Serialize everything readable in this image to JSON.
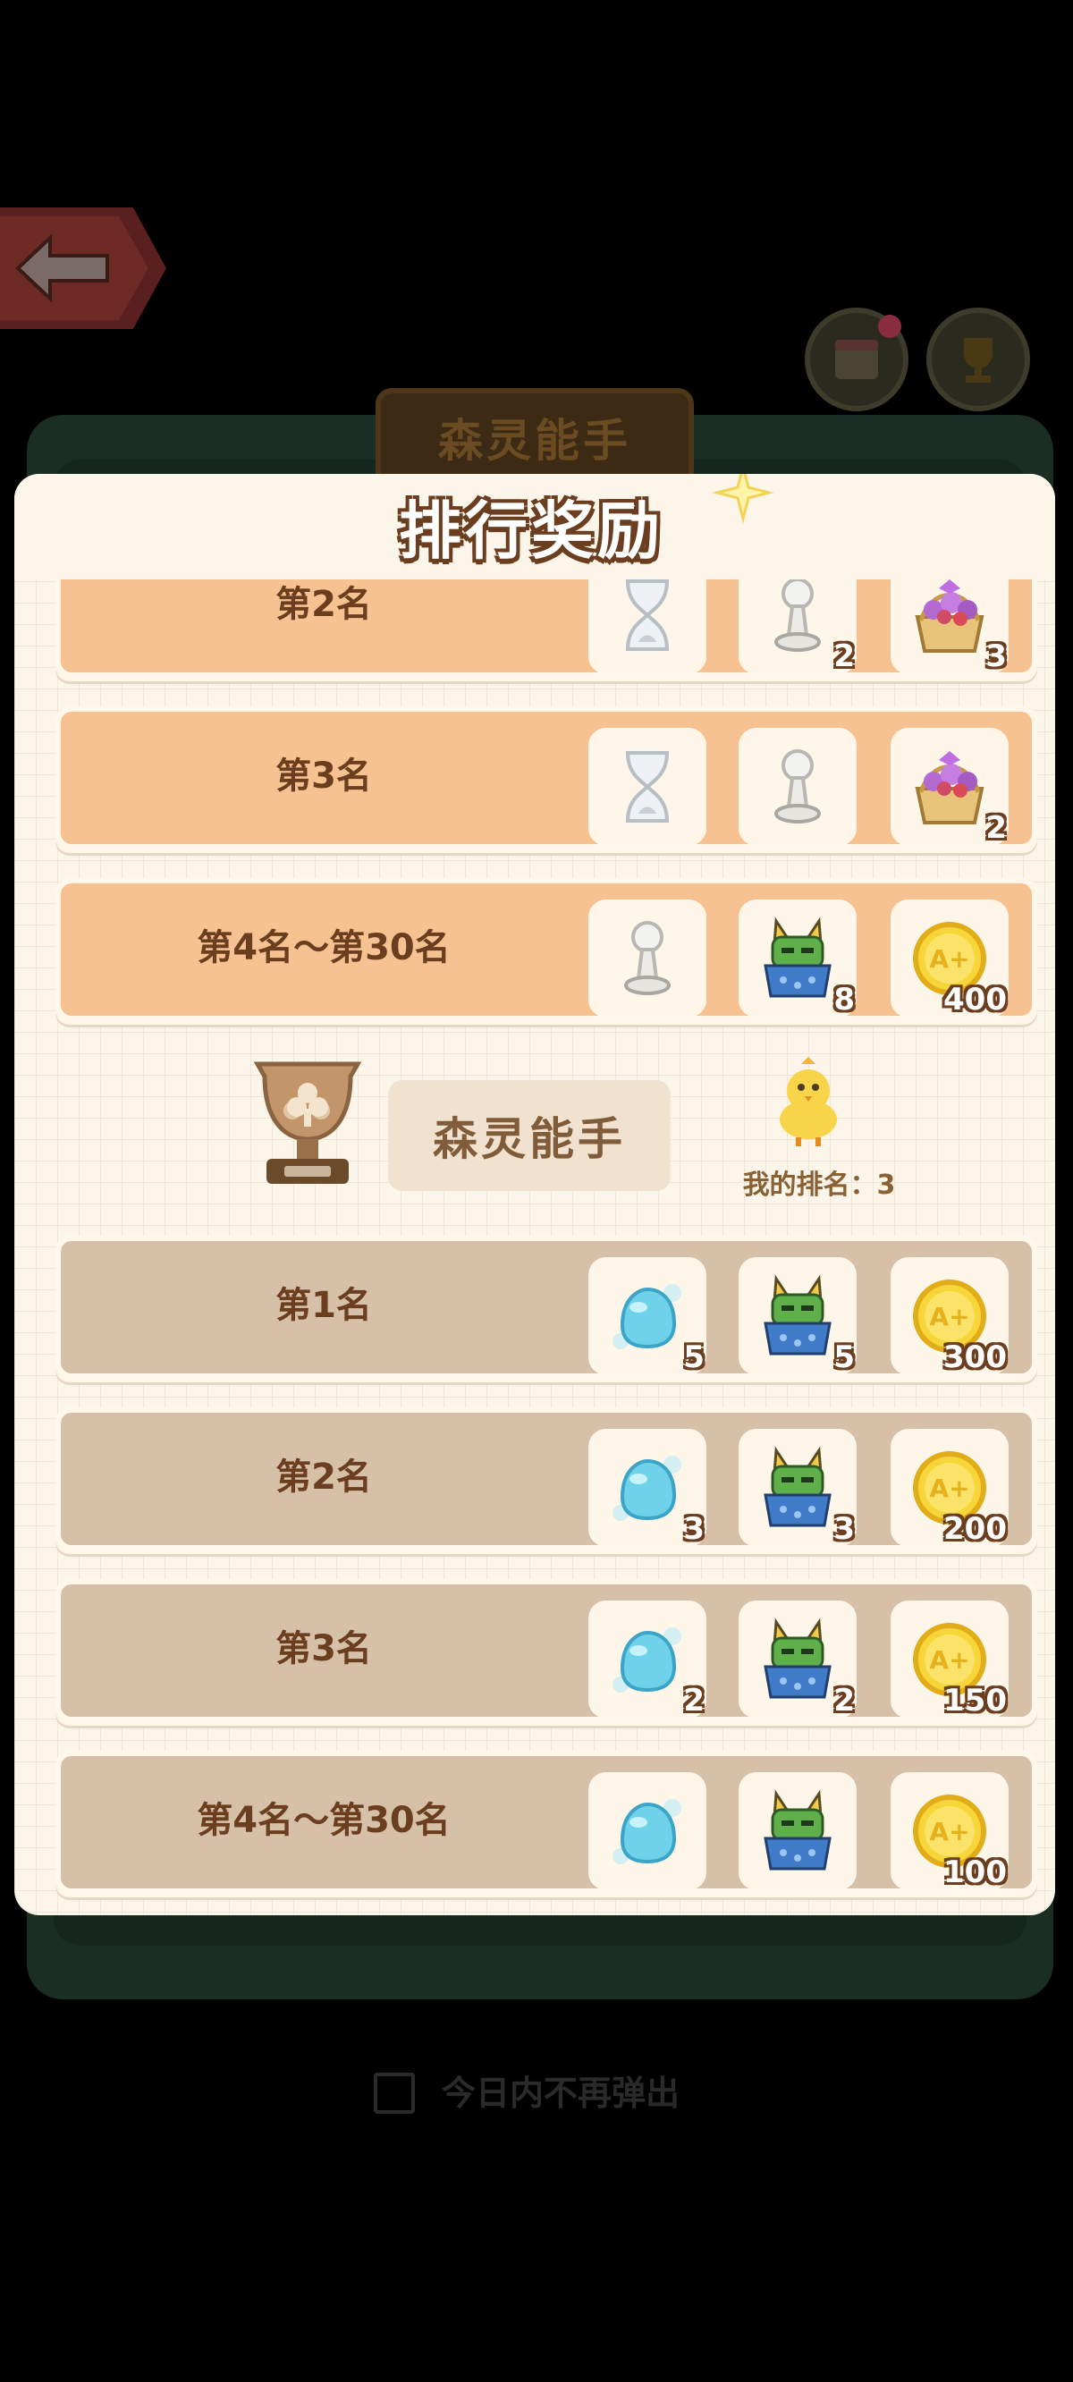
{
  "background": {
    "plaque_title": "森灵能手",
    "dont_show_today": "今日内不再弹出"
  },
  "panel": {
    "title": "排行奖励"
  },
  "groups": [
    {
      "style": "orange",
      "rows": [
        {
          "rank": "第2名",
          "items": [
            {
              "icon": "hourglass-icon",
              "count": ""
            },
            {
              "icon": "pawn-icon",
              "count": "2"
            },
            {
              "icon": "flower-basket-icon",
              "count": "3"
            }
          ]
        },
        {
          "rank": "第3名",
          "items": [
            {
              "icon": "hourglass-icon",
              "count": ""
            },
            {
              "icon": "pawn-icon",
              "count": ""
            },
            {
              "icon": "flower-basket-icon",
              "count": "2"
            }
          ]
        },
        {
          "rank": "第4名～第30名",
          "items": [
            {
              "icon": "pawn-icon",
              "count": ""
            },
            {
              "icon": "robot-cat-icon",
              "count": "8"
            },
            {
              "icon": "gold-coin-icon",
              "count": "400"
            }
          ]
        }
      ]
    },
    {
      "style": "tan",
      "header": {
        "name": "森灵能手",
        "my_rank_label": "我的排名：3"
      },
      "rows": [
        {
          "rank": "第1名",
          "items": [
            {
              "icon": "slime-icon",
              "count": "5"
            },
            {
              "icon": "robot-cat-icon",
              "count": "5"
            },
            {
              "icon": "gold-coin-icon",
              "count": "300"
            }
          ]
        },
        {
          "rank": "第2名",
          "items": [
            {
              "icon": "slime-icon",
              "count": "3"
            },
            {
              "icon": "robot-cat-icon",
              "count": "3"
            },
            {
              "icon": "gold-coin-icon",
              "count": "200"
            }
          ]
        },
        {
          "rank": "第3名",
          "items": [
            {
              "icon": "slime-icon",
              "count": "2"
            },
            {
              "icon": "robot-cat-icon",
              "count": "2"
            },
            {
              "icon": "gold-coin-icon",
              "count": "150"
            }
          ]
        },
        {
          "rank": "第4名～第30名",
          "items": [
            {
              "icon": "slime-icon",
              "count": ""
            },
            {
              "icon": "robot-cat-icon",
              "count": ""
            },
            {
              "icon": "gold-coin-icon",
              "count": "100"
            }
          ]
        }
      ]
    }
  ],
  "colors": {
    "row_orange": "#f6c291",
    "row_tan": "#d6c0a8",
    "text_brown": "#6b3e1f"
  }
}
